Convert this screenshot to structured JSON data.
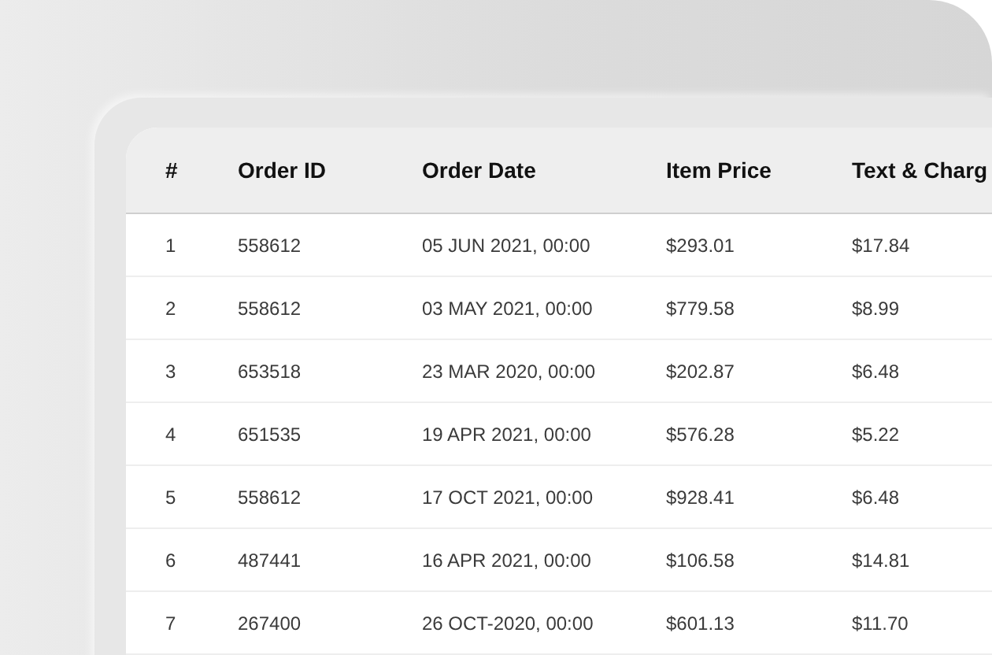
{
  "table": {
    "columns": [
      "#",
      "Order ID",
      "Order Date",
      "Item Price",
      "Text & Charg"
    ],
    "rows": [
      [
        "1",
        "558612",
        "05 JUN 2021, 00:00",
        "$293.01",
        "$17.84"
      ],
      [
        "2",
        "558612",
        "03 MAY 2021, 00:00",
        "$779.58",
        "$8.99"
      ],
      [
        "3",
        "653518",
        "23 MAR 2020, 00:00",
        "$202.87",
        "$6.48"
      ],
      [
        "4",
        "651535",
        "19 APR 2021, 00:00",
        "$576.28",
        "$5.22"
      ],
      [
        "5",
        "558612",
        "17 OCT 2021, 00:00",
        "$928.41",
        "$6.48"
      ],
      [
        "6",
        "487441",
        "16 APR 2021, 00:00",
        "$106.58",
        "$14.81"
      ],
      [
        "7",
        "267400",
        "26 OCT-2020, 00:00",
        "$601.13",
        "$11.70"
      ]
    ]
  }
}
